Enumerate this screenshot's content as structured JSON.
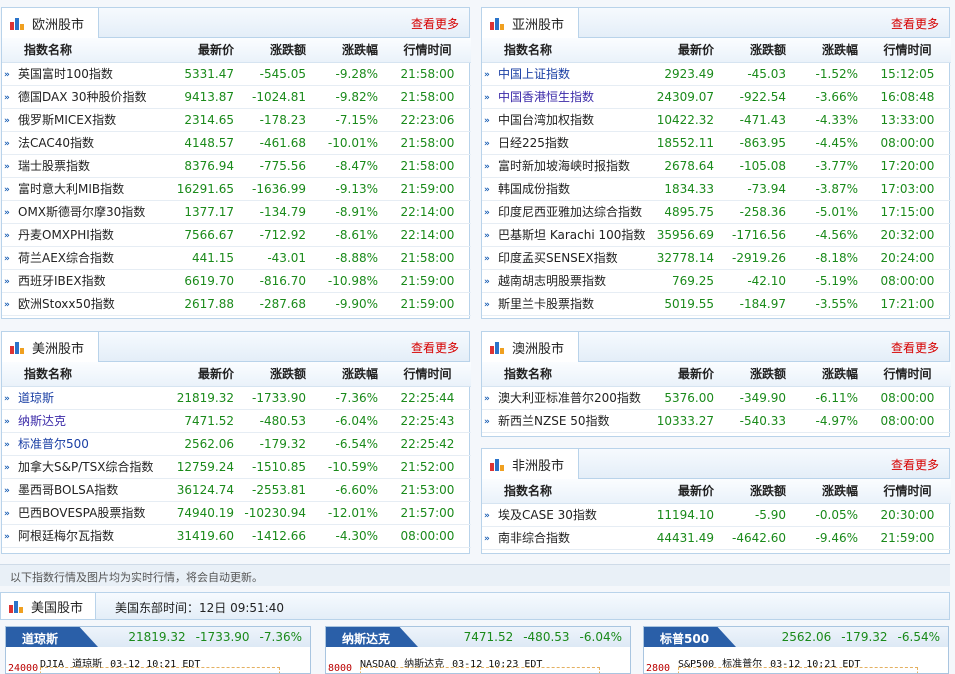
{
  "common": {
    "more_label": "查看更多",
    "col_name": "指数名称",
    "col_price": "最新价",
    "col_change": "涨跌额",
    "col_pct": "涨跌幅",
    "col_time": "行情时间",
    "icon": "chart-icon",
    "colors": {
      "up_down_text": "#1a8a1a",
      "more_link": "#d60000",
      "accent": "#2a5fa8"
    }
  },
  "europe": {
    "title": "欧洲股市",
    "rows": [
      {
        "name": "英国富时100指数",
        "price": "5331.47",
        "change": "-545.05",
        "pct": "-9.28%",
        "time": "21:58:00"
      },
      {
        "name": "德国DAX 30种股价指数",
        "price": "9413.87",
        "change": "-1024.81",
        "pct": "-9.82%",
        "time": "21:58:00"
      },
      {
        "name": "俄罗斯MICEX指数",
        "price": "2314.65",
        "change": "-178.23",
        "pct": "-7.15%",
        "time": "22:23:06"
      },
      {
        "name": "法CAC40指数",
        "price": "4148.57",
        "change": "-461.68",
        "pct": "-10.01%",
        "time": "21:58:00"
      },
      {
        "name": "瑞士股票指数",
        "price": "8376.94",
        "change": "-775.56",
        "pct": "-8.47%",
        "time": "21:58:00"
      },
      {
        "name": "富时意大利MIB指数",
        "price": "16291.65",
        "change": "-1636.99",
        "pct": "-9.13%",
        "time": "21:59:00"
      },
      {
        "name": "OMX斯德哥尔摩30指数",
        "price": "1377.17",
        "change": "-134.79",
        "pct": "-8.91%",
        "time": "22:14:00"
      },
      {
        "name": "丹麦OMXPHI指数",
        "price": "7566.67",
        "change": "-712.92",
        "pct": "-8.61%",
        "time": "22:14:00"
      },
      {
        "name": "荷兰AEX综合指数",
        "price": "441.15",
        "change": "-43.01",
        "pct": "-8.88%",
        "time": "21:58:00"
      },
      {
        "name": "西班牙IBEX指数",
        "price": "6619.70",
        "change": "-816.70",
        "pct": "-10.98%",
        "time": "21:59:00"
      },
      {
        "name": "欧洲Stoxx50指数",
        "price": "2617.88",
        "change": "-287.68",
        "pct": "-9.90%",
        "time": "21:59:00"
      }
    ]
  },
  "asia": {
    "title": "亚洲股市",
    "rows": [
      {
        "name": "中国上证指数",
        "price": "2923.49",
        "change": "-45.03",
        "pct": "-1.52%",
        "time": "15:12:05",
        "link": true
      },
      {
        "name": "中国香港恒生指数",
        "price": "24309.07",
        "change": "-922.54",
        "pct": "-3.66%",
        "time": "16:08:48",
        "link": true
      },
      {
        "name": "中国台湾加权指数",
        "price": "10422.32",
        "change": "-471.43",
        "pct": "-4.33%",
        "time": "13:33:00"
      },
      {
        "name": "日经225指数",
        "price": "18552.11",
        "change": "-863.95",
        "pct": "-4.45%",
        "time": "08:00:00"
      },
      {
        "name": "富时新加坡海峡时报指数",
        "price": "2678.64",
        "change": "-105.08",
        "pct": "-3.77%",
        "time": "17:20:00"
      },
      {
        "name": "韩国成份指数",
        "price": "1834.33",
        "change": "-73.94",
        "pct": "-3.87%",
        "time": "17:03:00"
      },
      {
        "name": "印度尼西亚雅加达综合指数",
        "price": "4895.75",
        "change": "-258.36",
        "pct": "-5.01%",
        "time": "17:15:00"
      },
      {
        "name": "巴基斯坦 Karachi 100指数",
        "price": "35956.69",
        "change": "-1716.56",
        "pct": "-4.56%",
        "time": "20:32:00"
      },
      {
        "name": "印度孟买SENSEX指数",
        "price": "32778.14",
        "change": "-2919.26",
        "pct": "-8.18%",
        "time": "20:24:00"
      },
      {
        "name": "越南胡志明股票指数",
        "price": "769.25",
        "change": "-42.10",
        "pct": "-5.19%",
        "time": "08:00:00"
      },
      {
        "name": "斯里兰卡股票指数",
        "price": "5019.55",
        "change": "-184.97",
        "pct": "-3.55%",
        "time": "17:21:00"
      }
    ]
  },
  "america": {
    "title": "美洲股市",
    "rows": [
      {
        "name": "道琼斯",
        "price": "21819.32",
        "change": "-1733.90",
        "pct": "-7.36%",
        "time": "22:25:44",
        "link": true
      },
      {
        "name": "纳斯达克",
        "price": "7471.52",
        "change": "-480.53",
        "pct": "-6.04%",
        "time": "22:25:43",
        "link": true
      },
      {
        "name": "标准普尔500",
        "price": "2562.06",
        "change": "-179.32",
        "pct": "-6.54%",
        "time": "22:25:42",
        "link": true
      },
      {
        "name": "加拿大S&P/TSX综合指数",
        "price": "12759.24",
        "change": "-1510.85",
        "pct": "-10.59%",
        "time": "21:52:00"
      },
      {
        "name": "墨西哥BOLSA指数",
        "price": "36124.74",
        "change": "-2553.81",
        "pct": "-6.60%",
        "time": "21:53:00"
      },
      {
        "name": "巴西BOVESPA股票指数",
        "price": "74940.19",
        "change": "-10230.94",
        "pct": "-12.01%",
        "time": "21:57:00"
      },
      {
        "name": "阿根廷梅尔瓦指数",
        "price": "31419.60",
        "change": "-1412.66",
        "pct": "-4.30%",
        "time": "08:00:00"
      }
    ]
  },
  "oceania": {
    "title": "澳洲股市",
    "rows": [
      {
        "name": "澳大利亚标准普尔200指数",
        "price": "5376.00",
        "change": "-349.90",
        "pct": "-6.11%",
        "time": "08:00:00"
      },
      {
        "name": "新西兰NZSE 50指数",
        "price": "10333.27",
        "change": "-540.33",
        "pct": "-4.97%",
        "time": "08:00:00"
      }
    ]
  },
  "africa": {
    "title": "非洲股市",
    "rows": [
      {
        "name": "埃及CASE 30指数",
        "price": "11194.10",
        "change": "-5.90",
        "pct": "-0.05%",
        "time": "20:30:00"
      },
      {
        "name": "南非综合指数",
        "price": "44431.49",
        "change": "-4642.60",
        "pct": "-9.46%",
        "time": "21:59:00"
      }
    ]
  },
  "notice": "以下指数行情及图片均为实时行情，将会自动更新。",
  "us_market": {
    "title": "美国股市",
    "time_label": "美国东部时间：12日 09:51:40",
    "cards": [
      {
        "tag": "道琼斯",
        "price": "21819.32",
        "change": "-1733.90",
        "pct": "-7.36%",
        "axis": "24000",
        "code": "DJIA",
        "name": "道琼斯",
        "stamp": "03-12 10:21 EDT"
      },
      {
        "tag": "纳斯达克",
        "price": "7471.52",
        "change": "-480.53",
        "pct": "-6.04%",
        "axis": "8000",
        "code": "NASDAQ",
        "name": "纳斯达克",
        "stamp": "03-12 10:23 EDT"
      },
      {
        "tag": "标普500",
        "price": "2562.06",
        "change": "-179.32",
        "pct": "-6.54%",
        "axis": "2800",
        "code": "S&P500",
        "name": "标准普尔",
        "stamp": "03-12 10:21 EDT"
      }
    ]
  }
}
